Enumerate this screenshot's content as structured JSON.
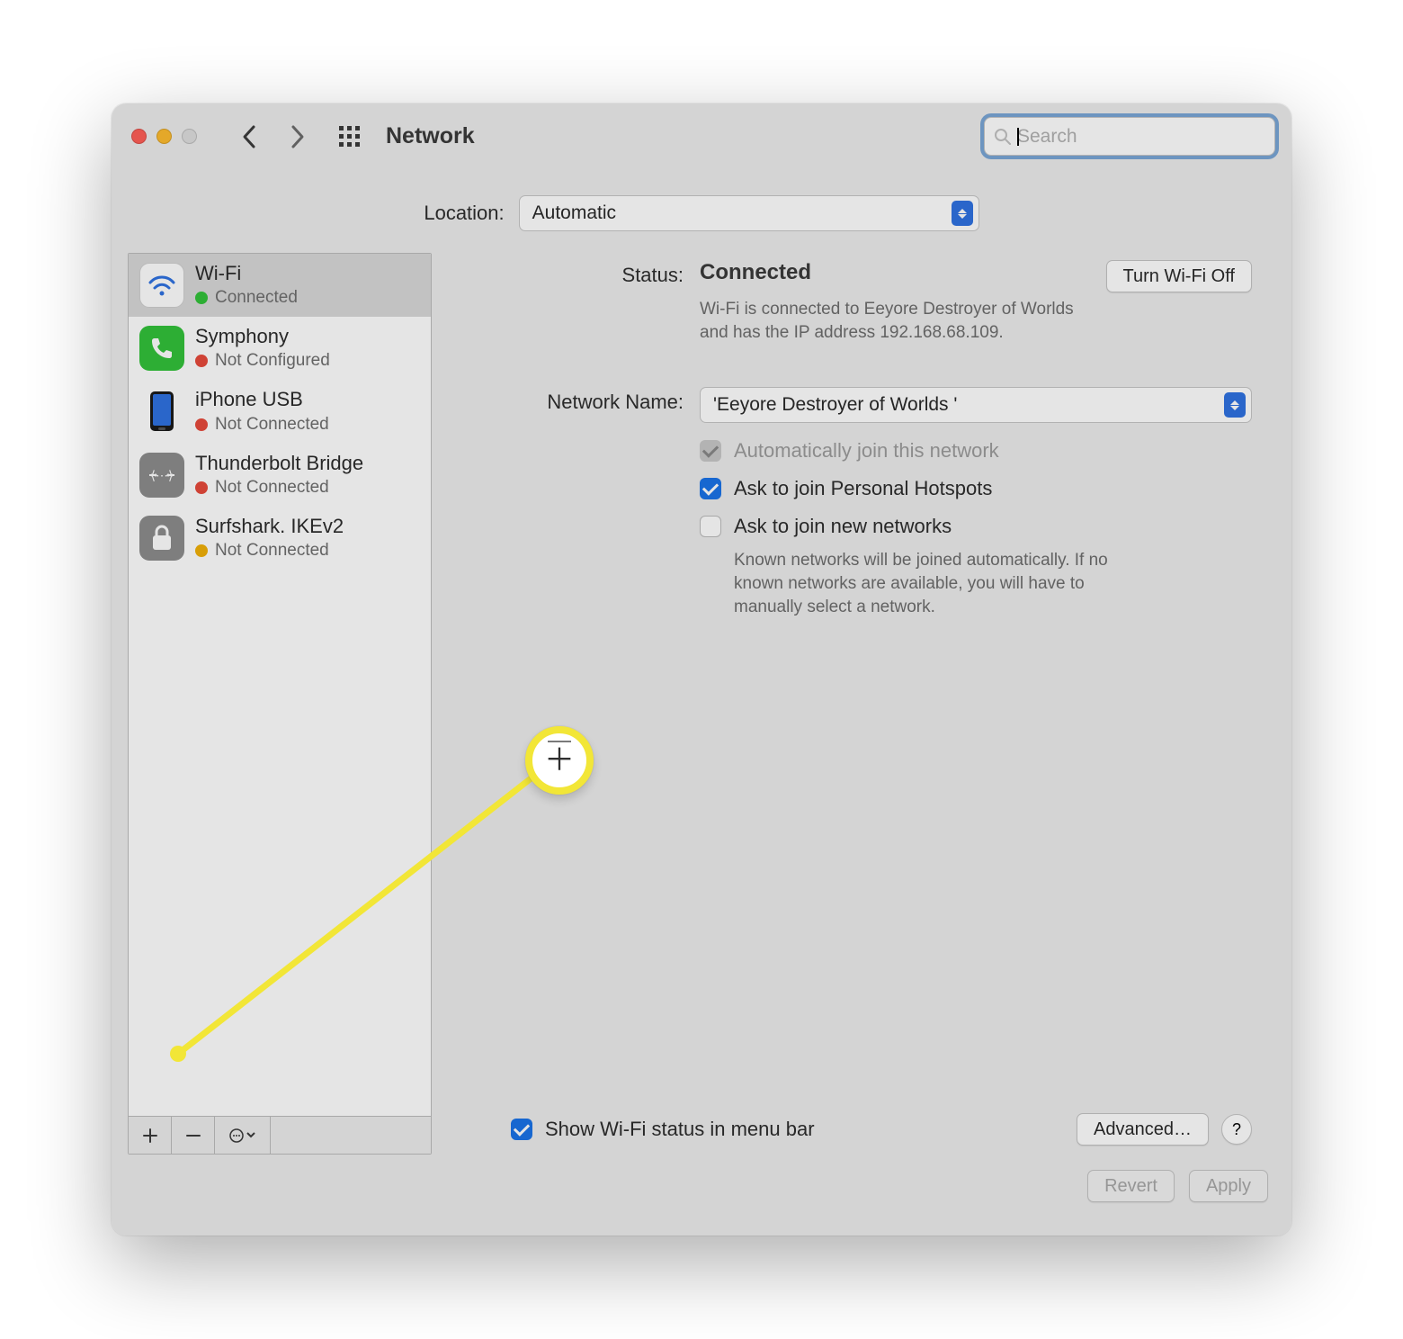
{
  "title": "Network",
  "search_placeholder": "Search",
  "location_label": "Location:",
  "location_value": "Automatic",
  "services": [
    {
      "name": "Wi-Fi",
      "status": "Connected",
      "selected": true,
      "dot": "green",
      "icon": "wifi"
    },
    {
      "name": "Symphony",
      "status": "Not Configured",
      "selected": false,
      "dot": "red",
      "icon": "phone"
    },
    {
      "name": "iPhone USB",
      "status": "Not Connected",
      "selected": false,
      "dot": "red",
      "icon": "iphone"
    },
    {
      "name": "Thunderbolt Bridge",
      "status": "Not Connected",
      "selected": false,
      "dot": "red",
      "icon": "thunderbolt"
    },
    {
      "name": "Surfshark. IKEv2",
      "status": "Not Connected",
      "selected": false,
      "dot": "yellow",
      "icon": "lock"
    }
  ],
  "main": {
    "status_label": "Status:",
    "status_value": "Connected",
    "wifi_off_button": "Turn Wi-Fi Off",
    "status_desc": "Wi-Fi is connected to Eeyore Destroyer of Worlds  and has the IP address 192.168.68.109.",
    "network_name_label": "Network Name:",
    "network_name_value": "'Eeyore Destroyer of Worlds '",
    "auto_join_label": "Automatically join this network",
    "ask_hotspot_label": "Ask to join Personal Hotspots",
    "ask_new_label": "Ask to join new networks",
    "known_desc": "Known networks will be joined automatically. If no known networks are available, you will have to manually select a network.",
    "show_menu_label": "Show Wi-Fi status in menu bar",
    "advanced_button": "Advanced…",
    "help_button": "?"
  },
  "footer": {
    "revert": "Revert",
    "apply": "Apply"
  }
}
